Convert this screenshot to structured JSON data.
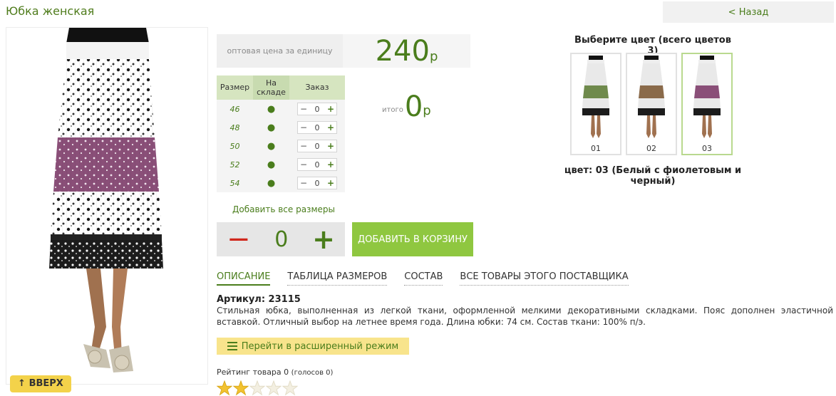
{
  "page_title": "Юбка женская",
  "back_label": "< Назад",
  "scroll_up_label": "ВВЕРХ",
  "price": {
    "label": "оптовая цена за единицу",
    "value": "240",
    "currency": "р"
  },
  "size_table": {
    "headers": {
      "size": "Размер",
      "stock": "На складе",
      "order": "Заказ"
    },
    "rows": [
      {
        "size": "46",
        "stock": "●",
        "minus": "−",
        "qty": "0",
        "plus": "+"
      },
      {
        "size": "48",
        "stock": "●",
        "minus": "−",
        "qty": "0",
        "plus": "+"
      },
      {
        "size": "50",
        "stock": "●",
        "minus": "−",
        "qty": "0",
        "plus": "+"
      },
      {
        "size": "52",
        "stock": "●",
        "minus": "−",
        "qty": "0",
        "plus": "+"
      },
      {
        "size": "54",
        "stock": "●",
        "minus": "−",
        "qty": "0",
        "plus": "+"
      }
    ]
  },
  "total": {
    "label": "итого",
    "value": "0",
    "currency": "р"
  },
  "add_all_sizes": "Добавить все размеры",
  "quantity": {
    "minus": "−",
    "value": "0",
    "plus": "+"
  },
  "add_to_cart": "ДОБАВИТЬ В КОРЗИНУ",
  "tabs": [
    {
      "label": "ОПИСАНИЕ",
      "active": true
    },
    {
      "label": "ТАБЛИЦА РАЗМЕРОВ",
      "active": false
    },
    {
      "label": "СОСТАВ",
      "active": false
    },
    {
      "label": "ВСЕ ТОВАРЫ ЭТОГО ПОСТАВЩИКА",
      "active": false
    }
  ],
  "article": "Артикул: 23115",
  "description": "Стильная юбка, выполненная из легкой ткани, оформленной мелкими декоративными складками. Пояс дополнен эластичной вставкой. Отличный выбор на летнее время года. Длина юбки: 74 см. Состав ткани: 100% п/э.",
  "advanced_mode": "Перейти в расширенный режим",
  "rating": {
    "label": "Рейтинг товара",
    "value": "0",
    "votes": "(голосов 0)",
    "stars_filled": 2
  },
  "color_picker": {
    "title": "Выберите цвет (всего цветов 3)",
    "swatches": [
      {
        "label": "01",
        "band": "#6f8a4c",
        "selected": false
      },
      {
        "label": "02",
        "band": "#8a6a4a",
        "selected": false
      },
      {
        "label": "03",
        "band": "#8a4f78",
        "selected": true
      }
    ],
    "selected_name": "цвет: 03 (Белый с фиолетовым и черный)"
  },
  "colors": {
    "brand_green": "#4a7d1c",
    "cart_button": "#8fc740",
    "minus_red": "#d0271c",
    "highlight_yellow": "#f8e48c",
    "skirt_purple": "#8a4f78"
  }
}
